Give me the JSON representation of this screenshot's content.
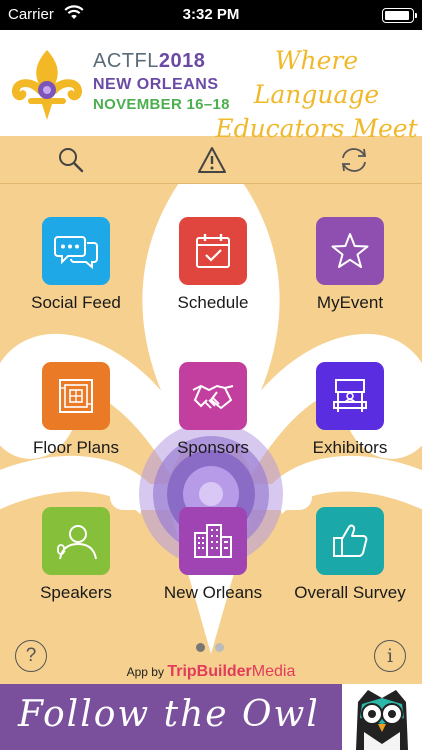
{
  "status_bar": {
    "carrier": "Carrier",
    "time": "3:32 PM"
  },
  "header": {
    "conf_name": "ACTFL",
    "conf_year": "2018",
    "city": "NEW ORLEANS",
    "dates": "NOVEMBER 16–18",
    "tagline": "Where Language Educators Meet"
  },
  "toolbar": {
    "search_icon": "search-icon",
    "alert_icon": "warning-icon",
    "refresh_icon": "refresh-icon"
  },
  "tiles": [
    {
      "label": "Social Feed",
      "color": "#1fa8e8",
      "icon": "chat-bubbles-icon"
    },
    {
      "label": "Schedule",
      "color": "#e0453e",
      "icon": "calendar-icon"
    },
    {
      "label": "MyEvent",
      "color": "#8e4fb0",
      "icon": "star-icon"
    },
    {
      "label": "Floor Plans",
      "color": "#ea7a26",
      "icon": "floor-plan-icon"
    },
    {
      "label": "Sponsors",
      "color": "#c23fa0",
      "icon": "handshake-icon"
    },
    {
      "label": "Exhibitors",
      "color": "#5a2de0",
      "icon": "booth-icon"
    },
    {
      "label": "Speakers",
      "color": "#86bf3a",
      "icon": "speaker-icon"
    },
    {
      "label": "New Orleans",
      "color": "#a044b4",
      "icon": "buildings-icon"
    },
    {
      "label": "Overall Survey",
      "color": "#1aa8a8",
      "icon": "thumbs-up-icon"
    }
  ],
  "footer": {
    "help_label": "?",
    "info_label": "i",
    "credit_prefix": "App by",
    "credit_brand1": "TripBuilder",
    "credit_brand2": "Media",
    "page_dots": {
      "count": 2,
      "active": 1
    }
  },
  "promo": {
    "text": "Follow the Owl"
  }
}
